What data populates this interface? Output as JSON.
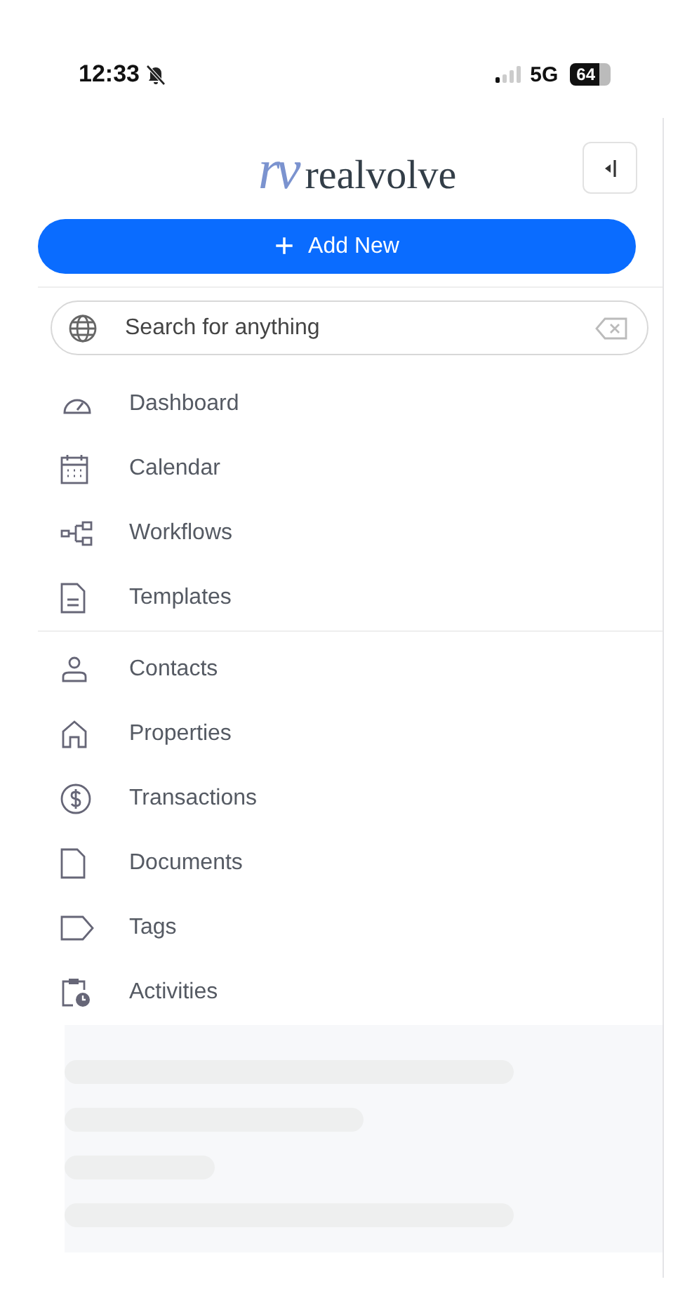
{
  "status_bar": {
    "time": "12:33",
    "network": "5G",
    "battery": "64"
  },
  "logo": {
    "mark": "rv",
    "name": "realvolve"
  },
  "add_button": {
    "label": "Add New",
    "icon": "+"
  },
  "search": {
    "placeholder": "Search for anything"
  },
  "nav_sections": [
    {
      "items": [
        {
          "label": "Dashboard",
          "kind": "gauge"
        },
        {
          "label": "Calendar",
          "kind": "calendar"
        },
        {
          "label": "Workflows",
          "kind": "workflow"
        },
        {
          "label": "Templates",
          "kind": "template"
        }
      ]
    },
    {
      "items": [
        {
          "label": "Contacts",
          "kind": "person"
        },
        {
          "label": "Properties",
          "kind": "house"
        },
        {
          "label": "Transactions",
          "kind": "dollar"
        },
        {
          "label": "Documents",
          "kind": "document"
        },
        {
          "label": "Tags",
          "kind": "tag"
        },
        {
          "label": "Activities",
          "kind": "activity"
        }
      ]
    }
  ]
}
